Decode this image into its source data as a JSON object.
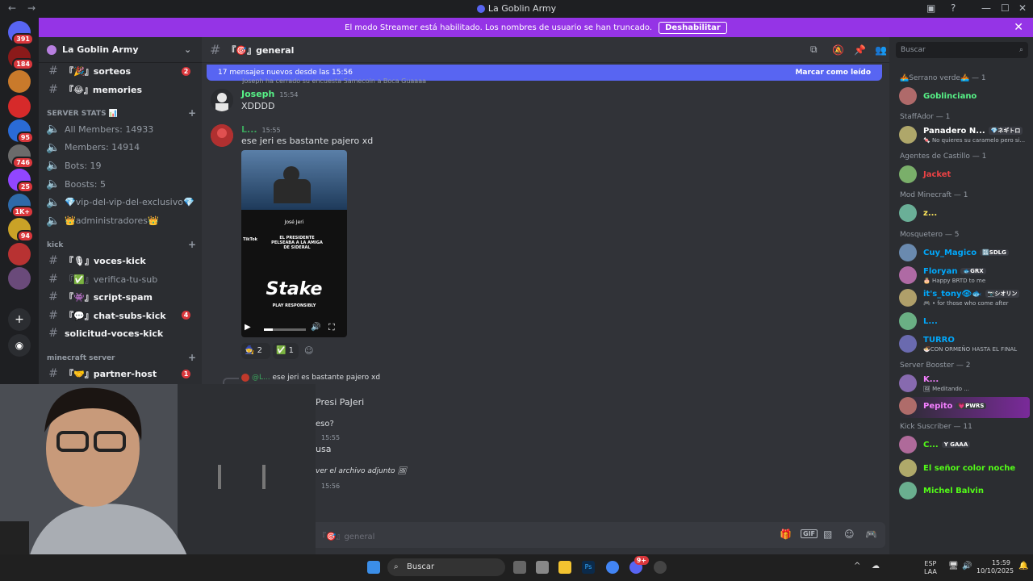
{
  "window": {
    "title": "La Goblin Army",
    "back": "←",
    "forward": "→"
  },
  "servers": [
    {
      "badge": "391",
      "color": "#5865f2"
    },
    {
      "badge": "184",
      "color": "#8b1a1a"
    },
    {
      "badge": "",
      "color": "#c97a2b"
    },
    {
      "badge": "",
      "color": "#d62a2a"
    },
    {
      "badge": "95",
      "color": "#2a6bd6"
    },
    {
      "badge": "746",
      "color": "#6b6b6b"
    },
    {
      "badge": "25",
      "color": "#9146ff"
    },
    {
      "badge": "1K+",
      "color": "#2e6aa8"
    },
    {
      "badge": "94",
      "color": "#c9a227"
    },
    {
      "badge": "",
      "color": "#b83232"
    },
    {
      "badge": "",
      "color": "#6a4a7a"
    }
  ],
  "banner": {
    "text": "El modo Streamer está habilitado. Los nombres de usuario se han truncado.",
    "button": "Deshabilitar",
    "close": "✕"
  },
  "server": {
    "name": "La Goblin Army"
  },
  "channels": {
    "top": [
      {
        "name": "『🎉』sorteos",
        "count": "2",
        "style": "bold"
      },
      {
        "name": "『😂』memories",
        "count": "",
        "style": "bold"
      }
    ],
    "stats_category": "SERVER STATS 📊",
    "stats": [
      "All Members: 14933",
      "Members: 14914",
      "Bots: 19",
      "Boosts: 5",
      "💎vip-del-vip-del-exclusivo💎",
      "👑administradores👑"
    ],
    "kick_category": "kick",
    "kick": [
      {
        "name": "『🎙』voces-kick",
        "count": "",
        "style": "bold"
      },
      {
        "name": "『✅』verifica-tu-sub",
        "count": "",
        "style": "dim"
      },
      {
        "name": "『👾』script-spam",
        "count": "",
        "style": "bold"
      },
      {
        "name": "『💬』chat-subs-kick",
        "count": "4",
        "style": "bold"
      },
      {
        "name": "solicitud-voces-kick",
        "count": "",
        "style": "bold"
      }
    ],
    "mc_category": "minecraft server",
    "mc": [
      {
        "name": "『🤝』partner-host",
        "count": "1",
        "style": "bold"
      }
    ]
  },
  "chat": {
    "channel": "『🎯』general",
    "new_messages": "17 mensajes nuevos desde las 15:56",
    "mark_read": "Marcar como leído",
    "system_line": "Joseph ha cerrado su encuesta Samecoin a Boca Guaaaa",
    "messages": [
      {
        "user": "Joseph",
        "time": "15:54",
        "text": "XDDDD",
        "color": "#57f287"
      },
      {
        "user": "L...",
        "time": "15:55",
        "text": "ese jeri es bastante pajero xd",
        "color": "#3ba55d"
      }
    ],
    "embed": {
      "name": "José Jeri",
      "caption": "EL PRESIDENTE PELSEABA A LA AMIGA DE SIDERAL",
      "brand": "Stake",
      "brand_sub": "PLAY RESPONSIBLY",
      "tiktok": "TikTok"
    },
    "reactions": [
      {
        "emoji": "🧙",
        "count": "2"
      },
      {
        "emoji": "✅",
        "count": "1"
      }
    ],
    "reply": {
      "user": "@L...",
      "text": "ese jeri es bastante pajero xd"
    },
    "partial": [
      {
        "text": "Presi PaJeri"
      },
      {
        "text": "eso?"
      },
      {
        "text": "15:55"
      },
      {
        "text": "usa"
      },
      {
        "text": "ver el archivo adjunto"
      },
      {
        "text": "15:56"
      }
    ],
    "input_placeholder": "『🎯』general"
  },
  "members": {
    "search": "Buscar",
    "groups": [
      {
        "title": "🚣Serrano verde🚣 — 1",
        "items": [
          {
            "name": "Goblinciano",
            "status": "",
            "color": "#57f287",
            "tag": ""
          }
        ]
      },
      {
        "title": "StaffAdor — 1",
        "items": [
          {
            "name": "Panadero N...",
            "status": "🍬 No quieres su caramelo pero si...",
            "color": "#ffffff",
            "tag": "💎ネギトロ"
          }
        ]
      },
      {
        "title": "Agentes de Castillo — 1",
        "items": [
          {
            "name": "Jacket",
            "status": "",
            "color": "#ed4245",
            "tag": ""
          }
        ]
      },
      {
        "title": "Mod Minecraft — 1",
        "items": [
          {
            "name": "z...",
            "status": "",
            "color": "#fee75c",
            "tag": ""
          }
        ]
      },
      {
        "title": "Mosquetero — 5",
        "items": [
          {
            "name": "Cuy_Magico",
            "status": "",
            "color": "#00a8fc",
            "tag": "🔣SDLG"
          },
          {
            "name": "Floryan",
            "status": "🎂 Happy BRTD to me",
            "color": "#00a8fc",
            "tag": "🐟GRX"
          },
          {
            "name": "it's_tony👁🐟",
            "status": "🎮 • for those who come after",
            "color": "#00a8fc",
            "tag": "📷シオリン"
          },
          {
            "name": "L...",
            "status": "",
            "color": "#00a8fc",
            "tag": ""
          },
          {
            "name": "TURRO",
            "status": "🍜CON ORMEÑO HASTA EL FINAL",
            "color": "#00a8fc",
            "tag": ""
          }
        ]
      },
      {
        "title": "Server Booster — 2",
        "items": [
          {
            "name": "K...",
            "status": "🖼 Meditando ...",
            "color": "#f47fff",
            "tag": ""
          },
          {
            "name": "Pepito",
            "status": "",
            "color": "#f47fff",
            "tag": "💗PWRS"
          }
        ]
      },
      {
        "title": "Kick Suscriber — 11",
        "items": [
          {
            "name": "C...",
            "status": "",
            "color": "#53fc18",
            "tag": "Y GAAA"
          },
          {
            "name": "El señor color noche",
            "status": "",
            "color": "#53fc18",
            "tag": ""
          },
          {
            "name": "Michel Balvin",
            "status": "",
            "color": "#53fc18",
            "tag": ""
          }
        ]
      }
    ]
  },
  "taskbar": {
    "search": "Buscar",
    "lang": "ESP",
    "lang2": "LAA",
    "time": "15:59",
    "date": "10/10/2025",
    "discord_badge": "9+"
  },
  "colors": {
    "accent": "#5865f2",
    "streamer_banner": "#9534e6",
    "mention_red": "#da373c"
  }
}
